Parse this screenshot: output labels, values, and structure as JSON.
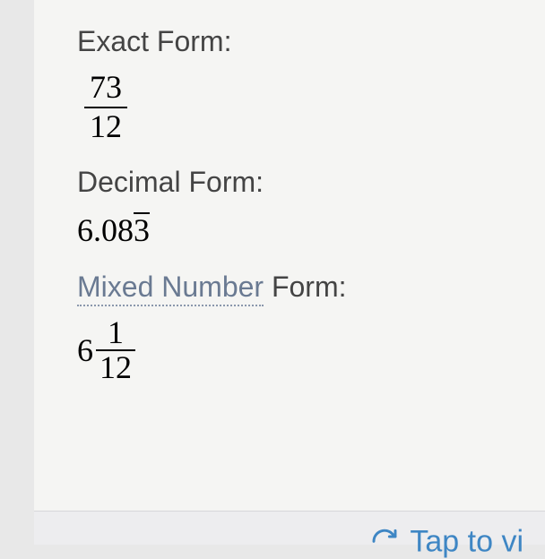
{
  "exact": {
    "label": "Exact Form:",
    "numerator": "73",
    "denominator": "12"
  },
  "decimal": {
    "label": "Decimal Form:",
    "leading": "6.08",
    "repeating": "3"
  },
  "mixed": {
    "link_term": "Mixed Number",
    "label_suffix": " Form:",
    "whole": "6",
    "numerator": "1",
    "denominator": "12"
  },
  "footer": {
    "link_text": "Tap to vi"
  }
}
